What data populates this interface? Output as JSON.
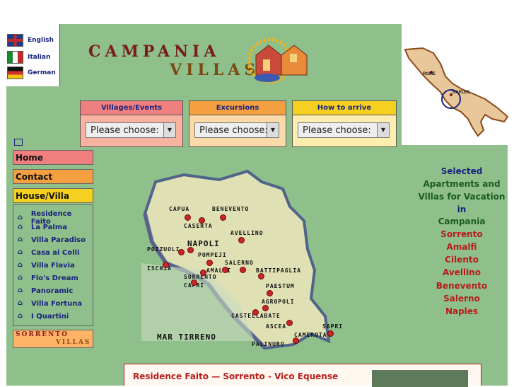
{
  "languages": [
    {
      "label": "English",
      "flag": "uk-flag-icon"
    },
    {
      "label": "Italian",
      "flag": "italy-flag-icon"
    },
    {
      "label": "German",
      "flag": "germany-flag-icon"
    }
  ],
  "logo": {
    "line1": "CAMPANIA",
    "line2": "VILLAS"
  },
  "italy_map": {
    "labels": [
      "ROME",
      "NAPLES"
    ]
  },
  "dropdowns": [
    {
      "heading": "Villages/Events",
      "value": "Please choose:",
      "color": "#f08080"
    },
    {
      "heading": "Excursions",
      "value": "Please choose:",
      "color": "#f5a040"
    },
    {
      "heading": "How to arrive",
      "value": "Please choose:",
      "color": "#f5d020"
    }
  ],
  "nav": {
    "home": "Home",
    "contact": "Contact",
    "house_villa": "House/Villa",
    "villas": [
      "Residence Faito",
      "La Palma",
      "Villa Paradiso",
      "Casa ai Colli",
      "Villa Flavia",
      "Flo's Dream",
      "Panoramic",
      "Villa Fortuna",
      "I Quartini"
    ],
    "sorrento_logo": {
      "line1": "SORRENTO",
      "line2": "VILLAS"
    }
  },
  "right_text": {
    "line1": "Selected",
    "line2": "Apartments and",
    "line3": "Villas for Vacation",
    "line4": "in",
    "line5": "Campania",
    "places": [
      "Sorrento",
      "Amalfi",
      "Cilento",
      "Avellino",
      "Benevento",
      "Salerno",
      "Naples"
    ]
  },
  "campania_map": {
    "cities": [
      "CAPUA",
      "BENEVENTO",
      "CASERTA",
      "AVELLINO",
      "POZZUOLI",
      "NAPOLI",
      "POMPEJI",
      "SALERNO",
      "ISCHIA",
      "AMALFI",
      "BATTIPAGLIA",
      "SORRENTO",
      "CAPRI",
      "PAESTUM",
      "AGROPOLI",
      "CASTELLABATE",
      "ASCEA",
      "SAPRI",
      "CAMEROTA",
      "PALINURO"
    ],
    "sea": "MAR TIRRENO"
  },
  "content": {
    "title": "Residence Faito — Sorrento - Vico Equense"
  }
}
